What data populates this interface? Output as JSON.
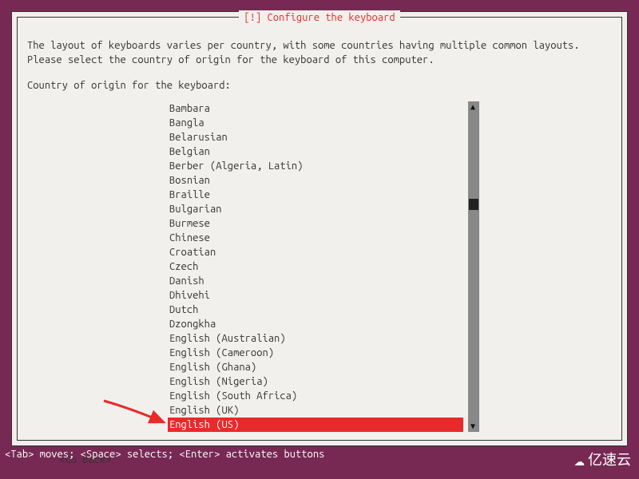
{
  "title": "[!] Configure the keyboard",
  "instructions": "The layout of keyboards varies per country, with some countries having multiple common layouts. Please select the country of origin for the keyboard of this computer.",
  "prompt": "Country of origin for the keyboard:",
  "items": [
    "Bambara",
    "Bangla",
    "Belarusian",
    "Belgian",
    "Berber (Algeria, Latin)",
    "Bosnian",
    "Braille",
    "Bulgarian",
    "Burmese",
    "Chinese",
    "Croatian",
    "Czech",
    "Danish",
    "Dhivehi",
    "Dutch",
    "Dzongkha",
    "English (Australian)",
    "English (Cameroon)",
    "English (Ghana)",
    "English (Nigeria)",
    "English (South Africa)",
    "English (UK)",
    "English (US)"
  ],
  "selected_index": 22,
  "go_back": "<Go Back>",
  "footer": "<Tab> moves; <Space> selects; <Enter> activates buttons",
  "watermark": "亿速云",
  "annotation_arrow_color": "#e82a2a"
}
